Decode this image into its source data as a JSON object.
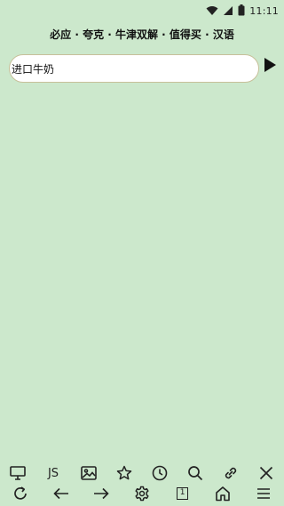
{
  "status_bar": {
    "time": "11:11",
    "icons": [
      "wifi-icon",
      "signal-icon",
      "battery-icon"
    ]
  },
  "header": {
    "title": "必应 · 夸克 · 牛津双解 · 值得买 · 汉语"
  },
  "search": {
    "value": "进口牛奶",
    "go_icon": "play-arrow-icon"
  },
  "toolbar_top": {
    "items": [
      "monitor-icon",
      "JS",
      "image-icon",
      "star-icon",
      "clock-icon",
      "search-icon",
      "link-icon",
      "close-icon"
    ]
  },
  "toolbar_bottom": {
    "items": [
      "refresh-icon",
      "back-arrow-icon",
      "forward-arrow-icon",
      "gear-icon",
      "tabs-icon",
      "home-icon",
      "menu-icon"
    ],
    "tab_count": "1"
  },
  "colors": {
    "background": "#cce8cc",
    "input_background": "#ffffff",
    "icon": "#222222"
  }
}
